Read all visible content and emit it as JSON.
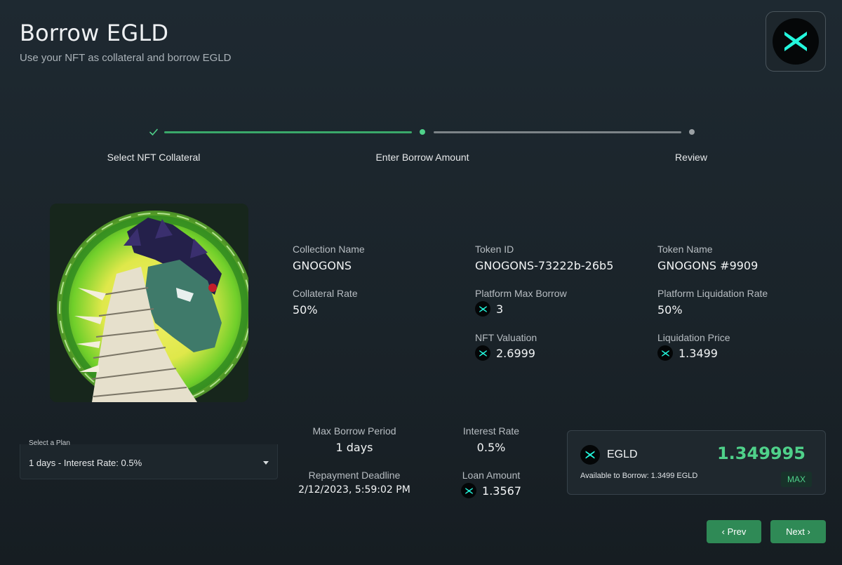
{
  "header": {
    "title": "Borrow EGLD",
    "subtitle": "Use your NFT as collateral and borrow EGLD",
    "logo_icon": "multiversx-logo-icon"
  },
  "stepper": {
    "steps": [
      {
        "label": "Select NFT Collateral",
        "state": "completed"
      },
      {
        "label": "Enter Borrow Amount",
        "state": "active"
      },
      {
        "label": "Review",
        "state": "pending"
      }
    ]
  },
  "nft": {
    "image_alt": "GNOGONS #9909 dragon artwork",
    "collection_name_label": "Collection Name",
    "collection_name": "GNOGONS",
    "token_id_label": "Token ID",
    "token_id": "GNOGONS-73222b-26b5",
    "token_name_label": "Token Name",
    "token_name": "GNOGONS #9909",
    "collateral_rate_label": "Collateral Rate",
    "collateral_rate": "50%",
    "platform_max_borrow_label": "Platform Max Borrow",
    "platform_max_borrow": "3",
    "platform_liquidation_rate_label": "Platform Liquidation Rate",
    "platform_liquidation_rate": "50%",
    "nft_valuation_label": "NFT Valuation",
    "nft_valuation": "2.6999",
    "liquidation_price_label": "Liquidation Price",
    "liquidation_price": "1.3499"
  },
  "plan": {
    "legend": "Select a Plan",
    "selected": "1 days - Interest Rate: 0.5%"
  },
  "loan": {
    "max_borrow_period_label": "Max Borrow Period",
    "max_borrow_period": "1 days",
    "interest_rate_label": "Interest Rate",
    "interest_rate": "0.5%",
    "repayment_deadline_label": "Repayment Deadline",
    "repayment_deadline": "2/12/2023, 5:59:02 PM",
    "loan_amount_label": "Loan Amount",
    "loan_amount": "1.3567"
  },
  "borrow": {
    "token": "EGLD",
    "amount": "1.349995",
    "available": "Available to Borrow: 1.3499 EGLD",
    "max_label": "MAX"
  },
  "nav": {
    "prev_label": "‹ Prev",
    "next_label": "Next ›"
  },
  "colors": {
    "accent_green": "#4fd18a",
    "button_green": "#2f8a56",
    "egld_teal": "#23f7dd"
  }
}
